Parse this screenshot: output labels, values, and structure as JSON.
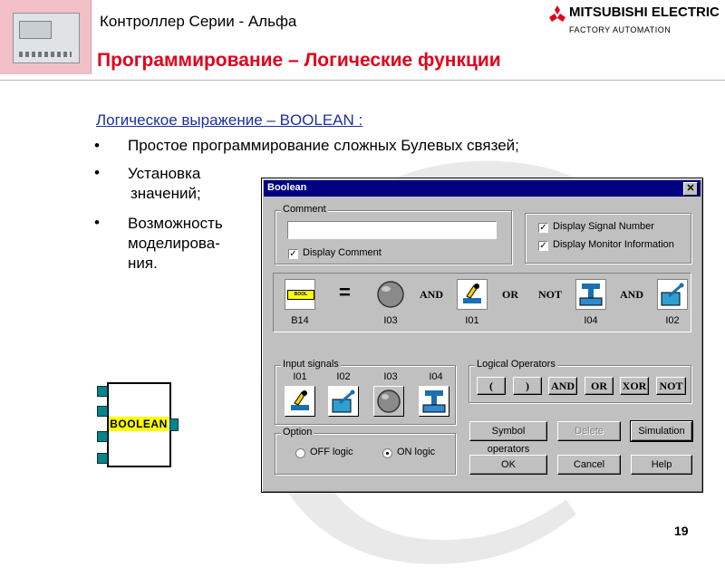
{
  "header": {
    "series_title": "Контроллер Серии - Альфа",
    "section_title": "Программирование – Логические функции",
    "logo_text": "MITSUBISHI ELECTRIC",
    "logo_subtext": "FACTORY AUTOMATION"
  },
  "content": {
    "heading": "Логическое выражение – BOOLEAN :",
    "bullets": [
      "Простое программирование  сложных Булевых связей;",
      "Установка значений;",
      "Возможность моделирова-ния."
    ],
    "bullet_lines": {
      "b2_line1": "Установка",
      "b2_line2": "значений;",
      "b3_line1": "Возможность",
      "b3_line2": "моделирова-",
      "b3_line3": "ния."
    },
    "function_block_label": "BOOLEAN"
  },
  "dialog": {
    "title": "Boolean",
    "close_glyph": "✕",
    "comment_group": "Comment",
    "comment_value": "",
    "display_comment": {
      "label": "Display Comment",
      "checked": true
    },
    "display_signal_number": {
      "label": "Display Signal Number",
      "checked": true
    },
    "display_monitor_info": {
      "label": "Display Monitor Information",
      "checked": true
    },
    "expression": {
      "result_label": "B14",
      "equals": "=",
      "tokens": [
        {
          "op": "",
          "signal": "I03",
          "icon": "lamp-icon"
        },
        {
          "op": "AND",
          "signal": "I01",
          "icon": "pushbutton-icon"
        },
        {
          "op": "OR NOT",
          "signal": "I04",
          "icon": "solenoid-icon"
        },
        {
          "op": "AND",
          "signal": "I02",
          "icon": "switch-icon"
        }
      ],
      "op1": "AND",
      "op2": "OR",
      "op3": "NOT",
      "op4": "AND",
      "sig1": "I03",
      "sig2": "I01",
      "sig3": "I04",
      "sig4": "I02"
    },
    "input_signals_group": "Input signals",
    "inputs": {
      "i01": {
        "label": "I01",
        "icon": "pushbutton-icon"
      },
      "i02": {
        "label": "I02",
        "icon": "switch-icon"
      },
      "i03": {
        "label": "I03",
        "icon": "lamp-icon"
      },
      "i04": {
        "label": "I04",
        "icon": "solenoid-icon"
      }
    },
    "logical_operators_group": "Logical Operators",
    "operators": {
      "open": "(",
      "close": ")",
      "and": "AND",
      "or": "OR",
      "xor": "XOR",
      "not": "NOT"
    },
    "option_group": "Option",
    "off_logic": {
      "label": "OFF logic",
      "selected": false
    },
    "on_logic": {
      "label": "ON logic",
      "selected": true
    },
    "buttons": {
      "symbol_operators": "Symbol operators",
      "delete": "Delete",
      "simulation": "Simulation",
      "ok": "OK",
      "cancel": "Cancel",
      "help": "Help"
    }
  },
  "footer": {
    "page_number": "19"
  },
  "colors": {
    "brand_red": "#e2001a",
    "heading_blue": "#1c2fa0",
    "dialog_title": "#000080",
    "dialog_bg": "#c0c0c0",
    "block_yellow": "#ffff00",
    "block_pin": "#08848c"
  }
}
